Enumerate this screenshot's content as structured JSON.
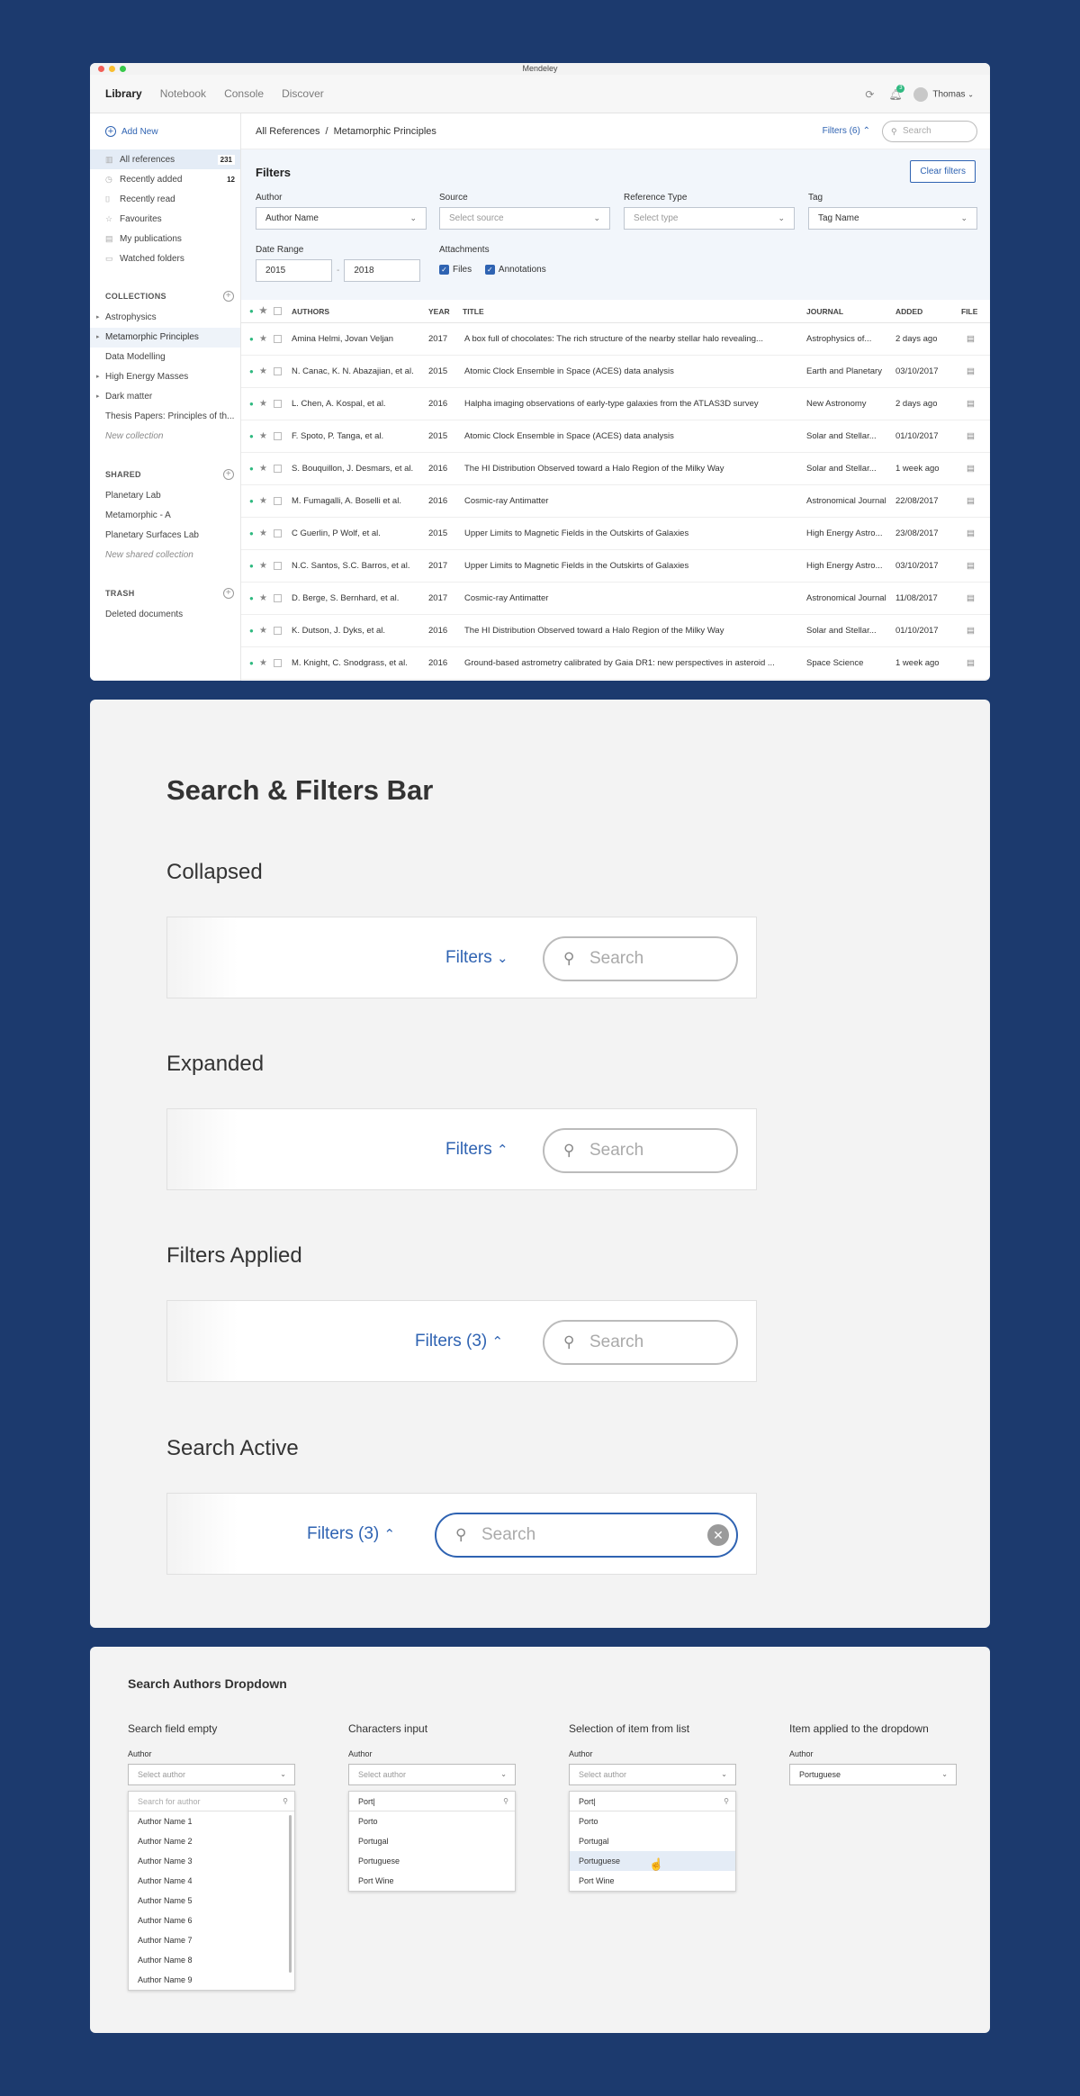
{
  "app": {
    "window_title": "Mendeley",
    "window_dot_colors": [
      "#f25f57",
      "#f9be2f",
      "#37c94a"
    ],
    "nav": [
      "Library",
      "Notebook",
      "Console",
      "Discover"
    ],
    "notification_count": "3",
    "user": "Thomas",
    "sidebar": {
      "add_new": "Add New",
      "items": [
        {
          "label": "All references",
          "count": "231",
          "icon": "references-icon"
        },
        {
          "label": "Recently added",
          "count": "12",
          "icon": "clock-icon"
        },
        {
          "label": "Recently read",
          "count": "",
          "icon": "bookmark-icon"
        },
        {
          "label": "Favourites",
          "count": "",
          "icon": "star-icon"
        },
        {
          "label": "My publications",
          "count": "",
          "icon": "document-icon"
        },
        {
          "label": "Watched folders",
          "count": "",
          "icon": "folder-icon"
        }
      ],
      "collections_title": "COLLECTIONS",
      "collections": [
        "Astrophysics",
        "Metamorphic Principles",
        "Data Modelling",
        "High Energy Masses",
        "Dark matter",
        "Thesis Papers: Principles of th...",
        "New collection"
      ],
      "shared_title": "SHARED",
      "shared": [
        "Planetary Lab",
        "Metamorphic - A",
        "Planetary Surfaces Lab",
        "New shared collection"
      ],
      "trash_title": "TRASH",
      "trash": [
        "Deleted documents"
      ]
    },
    "breadcrumb": [
      "All References",
      "Metamorphic Principles"
    ],
    "breadcrumb_sep": "/",
    "filters_toggle": "Filters (6)",
    "search_placeholder": "Search",
    "filters": {
      "title": "Filters",
      "clear": "Clear filters",
      "author_label": "Author",
      "author_value": "Author Name",
      "source_label": "Source",
      "source_value": "Select source",
      "type_label": "Reference Type",
      "type_value": "Select type",
      "tag_label": "Tag",
      "tag_value": "Tag Name",
      "date_label": "Date Range",
      "date_from": "2015",
      "date_to": "2018",
      "date_sep": "-",
      "attach_label": "Attachments",
      "attach_files": "Files",
      "attach_annotations": "Annotations"
    },
    "table": {
      "headers": [
        "AUTHORS",
        "YEAR",
        "TITLE",
        "JOURNAL",
        "ADDED",
        "FILE"
      ],
      "rows": [
        [
          "Amina Helmi, Jovan Veljan",
          "2017",
          "A box full of chocolates: The rich structure of the nearby stellar halo revealing...",
          "Astrophysics of...",
          "2 days ago"
        ],
        [
          "N. Canac, K. N. Abazajian, et al.",
          "2015",
          "Atomic Clock Ensemble in Space (ACES) data analysis",
          "Earth and Planetary",
          "03/10/2017"
        ],
        [
          "L. Chen, A. Kospal, et al.",
          "2016",
          "Halpha imaging observations of early-type galaxies from the ATLAS3D survey",
          "New Astronomy",
          "2 days ago"
        ],
        [
          "F. Spoto, P. Tanga, et al.",
          "2015",
          "Atomic Clock Ensemble in Space (ACES) data analysis",
          "Solar and Stellar...",
          "01/10/2017"
        ],
        [
          "S. Bouquillon, J. Desmars, et al.",
          "2016",
          "The HI Distribution Observed toward a Halo Region of the Milky Way",
          "Solar and Stellar...",
          "1 week ago"
        ],
        [
          "M. Fumagalli, A. Boselli et al.",
          "2016",
          "Cosmic-ray Antimatter",
          "Astronomical Journal",
          "22/08/2017"
        ],
        [
          "C Guerlin, P Wolf, et al.",
          "2015",
          "Upper Limits to Magnetic Fields in the Outskirts of Galaxies",
          "High Energy Astro...",
          "23/08/2017"
        ],
        [
          "N.C. Santos, S.C. Barros, et al.",
          "2017",
          "Upper Limits to Magnetic Fields in the Outskirts of Galaxies",
          "High Energy Astro...",
          "03/10/2017"
        ],
        [
          "D. Berge, S. Bernhard, et al.",
          "2017",
          "Cosmic-ray Antimatter",
          "Astronomical Journal",
          "11/08/2017"
        ],
        [
          "K. Dutson, J. Dyks, et al.",
          "2016",
          "The HI Distribution Observed toward a Halo Region of the Milky Way",
          "Solar and Stellar...",
          "01/10/2017"
        ],
        [
          "M. Knight, C. Snodgrass, et al.",
          "2016",
          "Ground-based astrometry calibrated by Gaia DR1: new perspectives in asteroid ...",
          "Space Science",
          "1 week ago"
        ]
      ]
    }
  },
  "states": {
    "title": "Search & Filters Bar",
    "items": [
      {
        "heading": "Collapsed",
        "filters": "Filters",
        "chevron": "⌄",
        "search": "Search"
      },
      {
        "heading": "Expanded",
        "filters": "Filters",
        "chevron": "⌃",
        "search": "Search"
      },
      {
        "heading": "Filters Applied",
        "filters": "Filters (3)",
        "chevron": "⌃",
        "search": "Search"
      },
      {
        "heading": "Search Active",
        "filters": "Filters (3)",
        "chevron": "⌃",
        "search": "Search"
      }
    ]
  },
  "dropdowns": {
    "title": "Search Authors Dropdown",
    "columns": [
      {
        "heading": "Search field empty",
        "label": "Author",
        "value": "Select author",
        "search": "Search for author",
        "options": [
          "Author Name 1",
          "Author Name 2",
          "Author Name 3",
          "Author Name 4",
          "Author Name 5",
          "Author Name 6",
          "Author Name 7",
          "Author Name 8",
          "Author Name 9"
        ]
      },
      {
        "heading": "Characters input",
        "label": "Author",
        "value": "Select author",
        "search": "Port|",
        "options": [
          "Porto",
          "Portugal",
          "Portuguese",
          "Port Wine"
        ]
      },
      {
        "heading": "Selection of item from list",
        "label": "Author",
        "value": "Select author",
        "search": "Port|",
        "options": [
          "Porto",
          "Portugal",
          "Portuguese",
          "Port Wine"
        ]
      },
      {
        "heading": "Item applied to the dropdown",
        "label": "Author",
        "value": "Portuguese"
      }
    ]
  },
  "colors": {
    "accent": "#2f63b2",
    "background": "#1c3a6e",
    "green": "#2fb980"
  }
}
